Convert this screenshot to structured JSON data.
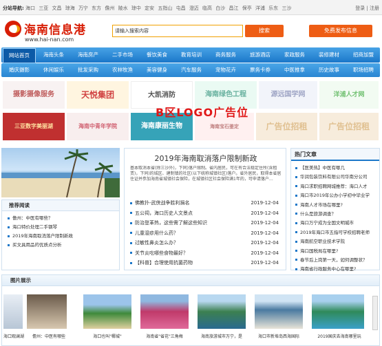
{
  "topbar": {
    "label": "分站导航:",
    "cities": [
      "海口",
      "三亚",
      "文昌",
      "琼海",
      "万宁",
      "东方",
      "儋州",
      "陵水",
      "琼中",
      "定安",
      "五指山",
      "屯昌",
      "澄迈",
      "临高",
      "白沙",
      "昌江",
      "保亭",
      "洋浦",
      "乐东",
      "三沙"
    ],
    "login": "登录",
    "register": "注册"
  },
  "header": {
    "logo_cn": "海南信息港",
    "logo_url": "www.hai-nan.com",
    "search_placeholder": "请输入搜索内容",
    "search_button": "搜索",
    "free_publish": "免费发布信息"
  },
  "nav_primary": [
    "网站首页",
    "海南头条",
    "海南房产",
    "二手市场",
    "餐饮美食",
    "教育培训",
    "商务服务",
    "旅游酒店",
    "家政服务",
    "装修建材",
    "招商加盟"
  ],
  "nav_secondary": [
    "婚庆摄影",
    "休闲娱乐",
    "批发采购",
    "农林牧渔",
    "美容健身",
    "汽车服务",
    "宠物花卉",
    "票务卡券",
    "中医推拿",
    "历史故事",
    "职场招聘"
  ],
  "ads": {
    "banner_text": "B区LOGO广告位",
    "items": [
      "摄影摄像服务",
      "天悦集团",
      "大凯消防",
      "海南绿色工程",
      "源远国学网",
      "洋浦人才网",
      "三亚数字美丽湖",
      "海南中青年学院",
      "海南康丽生物",
      "海南宝石鉴定",
      "广告位招租",
      "广告位招租"
    ]
  },
  "headline": {
    "title": "2019年海南取消落户限制新政",
    "summary": "基本取消本省(除三沙外)，下同)落户限制。省内居民，可在有合法稳定住所(含租赁)，下同)的城区、建制镇的社区(以下统称城镇社区)落户。省外居民，取得本省居住证并参加海南省城镇社会保险，在城镇社区社会保险满1年的，可申请落户…"
  },
  "news_list": [
    {
      "title": "佛教扑-武侠战争胜利捐名",
      "date": "2019-12-04"
    },
    {
      "title": "五公祠，海口历史人文景点",
      "date": "2019-12-04"
    },
    {
      "title": "防治登革热，这些需了解这些知识",
      "date": "2019-12-04"
    },
    {
      "title": "儿童湿疹用什么药？",
      "date": "2019-12-04"
    },
    {
      "title": "过敏性鼻炎怎么办？",
      "date": "2019-12-04"
    },
    {
      "title": "关节炎吃哪些食物最好？",
      "date": "2019-12-04"
    },
    {
      "title": "【科普】合理使用抗菌药物",
      "date": "2019-12-04"
    }
  ],
  "recommend": {
    "title": "推荐阅读",
    "items": [
      "儋州：中医有哪些？",
      "海口特价处理二手钢琴",
      "2019年海南取消落户限制新政",
      "买文具用品的优质点分析"
    ]
  },
  "hot": {
    "title": "热门文章",
    "items": [
      "【医美热】中医有哪几",
      "华润包装饮料有限公司华南分公司",
      "海口求职招聘网城推荐：海口人才",
      "海口市2019年公办小学初中毕业学",
      "海南人才市场在哪里?",
      "什么是旅游调查？",
      "海口万宁成为全国文明城市",
      "2019年海口市五指可学校招聘老师",
      "海南航空职业技术学院",
      "海口国税局在哪里?",
      "春节后上岗第一天，如何调整状？",
      "海南省行政服务中心在哪里?"
    ]
  },
  "photos": {
    "title": "图片展示",
    "items": [
      "海口观澜湖",
      "儋州：中医有哪些",
      "海口也叫\"椰城\"",
      "海南省\"省花\"三角梅",
      "海南旅游城市万宁，是",
      "海口市新埠岛西海国际",
      "2019国庆去海南哪里玩"
    ]
  },
  "colors": {
    "brand_red": "#d81e06",
    "nav_blue": "#1b77c9",
    "accent_orange": "#ee5d14"
  }
}
